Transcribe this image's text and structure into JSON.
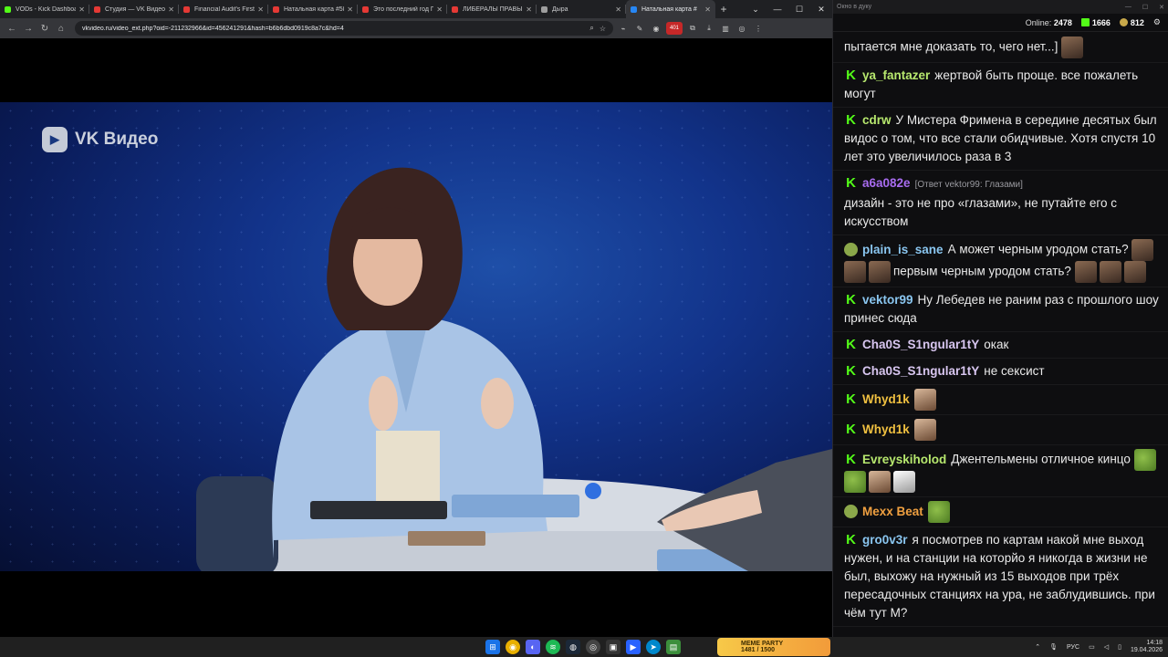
{
  "browser": {
    "tabs": [
      {
        "label": "VODs - Kick Dashboard",
        "color": "#53fc18"
      },
      {
        "label": "Студия — VK Видео Li",
        "color": "#e53935"
      },
      {
        "label": "Financial Audit's First I",
        "color": "#e53935"
      },
      {
        "label": "Натальная карта #58 №",
        "color": "#e53935"
      },
      {
        "label": "Это последний год Пу",
        "color": "#e53935"
      },
      {
        "label": "ЛИБЕРАЛЫ ПРАВЫ В",
        "color": "#e53935"
      },
      {
        "label": "Дыра",
        "color": "#9e9e9e"
      },
      {
        "label": "Натальная карта #",
        "color": "#2787f5"
      }
    ],
    "url": "vkvideo.ru/video_ext.php?oid=-211232966&id=456241291&hash=b6b6dbd0919c8a7c&hd=4",
    "ext_badge": "401"
  },
  "video": {
    "logo_text": "VK Видео"
  },
  "chat": {
    "popup_title": "Окно в дуку",
    "online_label": "Online:",
    "online_count": "2478",
    "followers": "1666",
    "points": "812",
    "messages": [
      {
        "user": "",
        "user_color": "#eaeaea",
        "text": "пытается мне доказать то, чего нет...]",
        "badge": "none",
        "emotes": [
          "face"
        ]
      },
      {
        "user": "ya_fantazer",
        "user_color": "#b7e86e",
        "text": "жертвой быть проще. все пожалеть могут",
        "badge": "k",
        "emotes": []
      },
      {
        "user": "cdrw",
        "user_color": "#b7e86e",
        "text": "У Мистера Фримена в середине десятых был видос о том, что все стали обидчивые. Хотя спустя 10 лет это увеличилось раза в 3",
        "badge": "k",
        "emotes": []
      },
      {
        "user": "a6a082e",
        "user_color": "#a86cf0",
        "reply": "[Ответ vektor99: Глазами]",
        "text": "дизайн - это не про «глазами», не путайте его с искусством",
        "badge": "k",
        "emotes": []
      },
      {
        "user": "plain_is_sane",
        "user_color": "#8ac6f0",
        "text": "А может черным уродом стать?",
        "text2": "первым черным уродом стать?",
        "badge": "frog",
        "emotes": [
          "face",
          "face",
          "face"
        ],
        "emotes2": [
          "face",
          "face",
          "face"
        ]
      },
      {
        "user": "vektor99",
        "user_color": "#8ac6f0",
        "text": "Ну Лебедев не раним раз с прошлого шоу принес сюда",
        "badge": "k",
        "emotes": []
      },
      {
        "user": "Cha0S_S1ngular1tY",
        "user_color": "#d8c6f0",
        "text": "окак",
        "badge": "k",
        "emotes": []
      },
      {
        "user": "Cha0S_S1ngular1tY",
        "user_color": "#d8c6f0",
        "text": "не сексист",
        "badge": "k",
        "emotes": []
      },
      {
        "user": "Whyd1k",
        "user_color": "#f0c040",
        "text": "",
        "badge": "k",
        "emotes": [
          "face2"
        ]
      },
      {
        "user": "Whyd1k",
        "user_color": "#f0c040",
        "text": "",
        "badge": "k",
        "emotes": [
          "face2"
        ]
      },
      {
        "user": "Evreyskiholod",
        "user_color": "#b7e86e",
        "text": "Джентельмены отличное кинцо",
        "badge": "k",
        "emotes": [
          "frog",
          "frog",
          "face2",
          "hand"
        ]
      },
      {
        "user": "Mexx Beat",
        "user_color": "#f0a040",
        "text": "",
        "badge": "frog",
        "emotes": [
          "frog"
        ]
      },
      {
        "user": "gro0v3r",
        "user_color": "#8ac6f0",
        "text": "я посмотрев по картам накой мне выход нужен, и на станции на которйо я никогда в жизни не был, выхожу на нужный из 15 выходов при трёх пересадочных станциях на ура, не заблудившись. при чём тут М?",
        "badge": "k",
        "emotes": []
      }
    ]
  },
  "taskbar": {
    "app_title": "MEME PARTY",
    "app_sub": "1481 / 1500",
    "lang": "РУС",
    "time": "14:18",
    "date": "19.04.2026"
  }
}
